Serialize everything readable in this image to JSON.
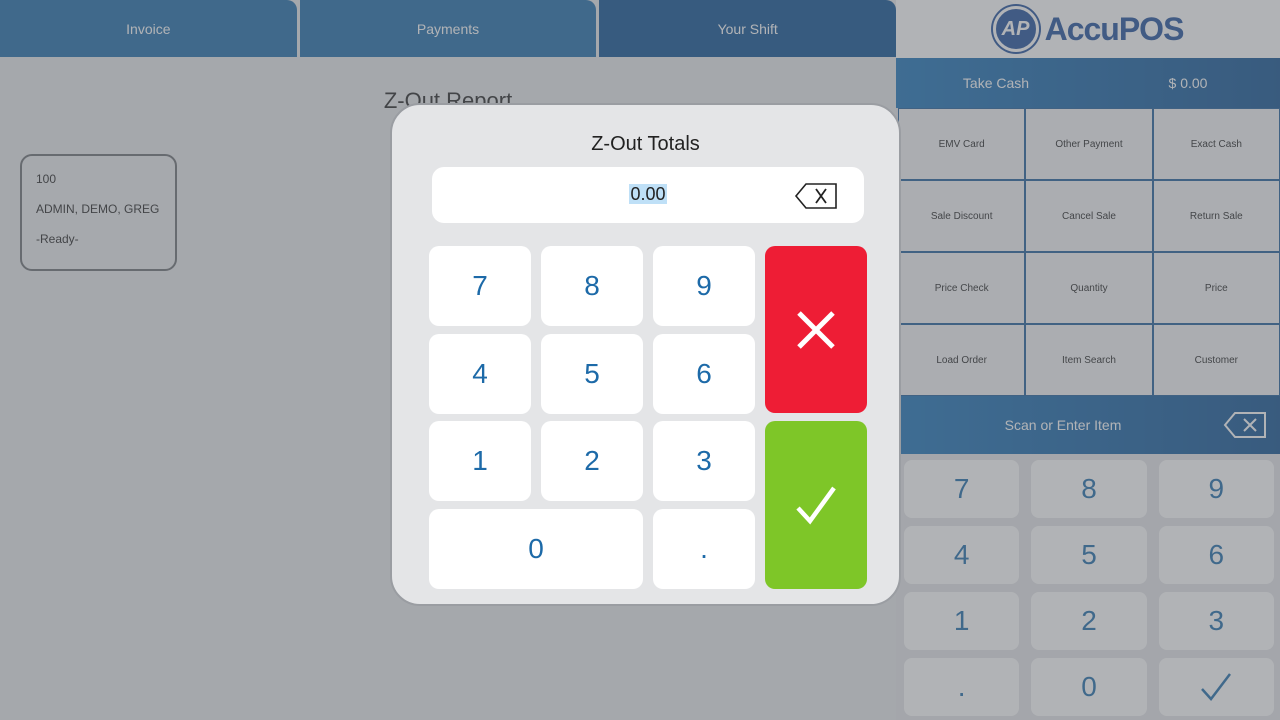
{
  "tabs": [
    {
      "label": "Invoice",
      "active": false
    },
    {
      "label": "Payments",
      "active": false
    },
    {
      "label": "Your Shift",
      "active": true
    }
  ],
  "report": {
    "title": "Z-Out Report"
  },
  "shift_card": {
    "number": "100",
    "user": "ADMIN, DEMO, GREG",
    "status": "-Ready-"
  },
  "logo": {
    "mark": "AP",
    "name": "AccuPOS"
  },
  "take_cash": {
    "label": "Take Cash",
    "amount": "$ 0.00"
  },
  "function_buttons": [
    "EMV Card",
    "Other Payment",
    "Exact Cash",
    "Sale Discount",
    "Cancel Sale",
    "Return Sale",
    "Price Check",
    "Quantity",
    "Price",
    "Load Order",
    "Item Search",
    "Customer"
  ],
  "scan": {
    "placeholder": "Scan or Enter Item"
  },
  "pos_keypad": [
    "7",
    "8",
    "9",
    "4",
    "5",
    "6",
    "1",
    "2",
    "3",
    ".",
    "0"
  ],
  "modal": {
    "title": "Z-Out Totals",
    "value": "0.00",
    "keys": {
      "k7": "7",
      "k8": "8",
      "k9": "9",
      "k4": "4",
      "k5": "5",
      "k6": "6",
      "k1": "1",
      "k2": "2",
      "k3": "3",
      "k0": "0",
      "kdot": "."
    }
  },
  "colors": {
    "tab": "#1d6aa8",
    "tab_active": "#0b4f91",
    "key_text": "#1d6aa8",
    "cancel": "#ee1d35",
    "confirm": "#7ec628"
  }
}
